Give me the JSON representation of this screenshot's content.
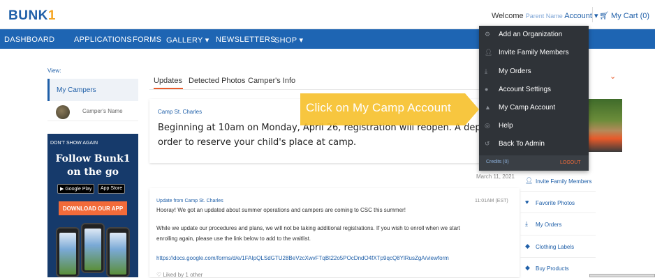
{
  "header": {
    "logo_text": "BUNK",
    "logo_accent": "1",
    "welcome_prefix": "Welcome",
    "parent_name": "Parent Name",
    "account_label": "Account ▾",
    "cart_label": "My Cart (0)"
  },
  "nav": {
    "items": [
      "DASHBOARD",
      "APPLICATIONS",
      "FORMS",
      "GALLERY ▾",
      "NEWSLETTERS",
      "SHOP ▾"
    ]
  },
  "sidebar": {
    "view_label": "View:",
    "my_campers": "My Campers",
    "camper_name": "Camper's Name",
    "promo": {
      "dont_show": "DON'T SHOW AGAIN",
      "line1": "Follow Bunk1",
      "line2": "on the go",
      "google_play": "Google Play",
      "app_store": "App Store",
      "download": "DOWNLOAD OUR APP"
    }
  },
  "tabs": [
    "Updates",
    "Detected Photos",
    "Camper's Info"
  ],
  "post1": {
    "source": "Camp St. Charles",
    "line1": "Beginning at 10am on Monday, April 26, registration will reopen. A deposit must be m",
    "line2": "order to reserve your child's place at camp."
  },
  "date": "March 11, 2021",
  "post2": {
    "source": "Update from Camp St. Charles",
    "time": "11:01AM (EST)",
    "p1": "Hooray! We got an updated about summer operations and campers are coming to CSC this summer!",
    "p2a": "While we update our procedures and plans, we will not be taking additional registrations. If you wish to enroll when we start",
    "p2b": "enrolling again, please use the link below to add to the waitlist.",
    "link": "https://docs.google.com/forms/d/e/1FAIpQLSdGTU28BeVzcXwvFTqBt22o5POcDndO4fXTp9qcQ8YlRusZgA/viewform",
    "liked": "Liked by 1 other"
  },
  "right_links": [
    "Invite Family Members",
    "Favorite Photos",
    "My Orders",
    "Clothing Labels",
    "Buy Products"
  ],
  "dropdown": {
    "items": [
      "Add an Organization",
      "Invite Family Members",
      "My Orders",
      "Account Settings",
      "My Camp Account",
      "Help",
      "Back To Admin"
    ],
    "credits": "Credits (0)",
    "logout": "LOGOUT"
  },
  "callout": {
    "text": "Click on My Camp Account"
  },
  "colors": {
    "brand_blue": "#1e65b3",
    "accent_orange": "#e85a2a",
    "callout_yellow": "#f6c12f",
    "dropdown_bg": "#2f3338"
  }
}
